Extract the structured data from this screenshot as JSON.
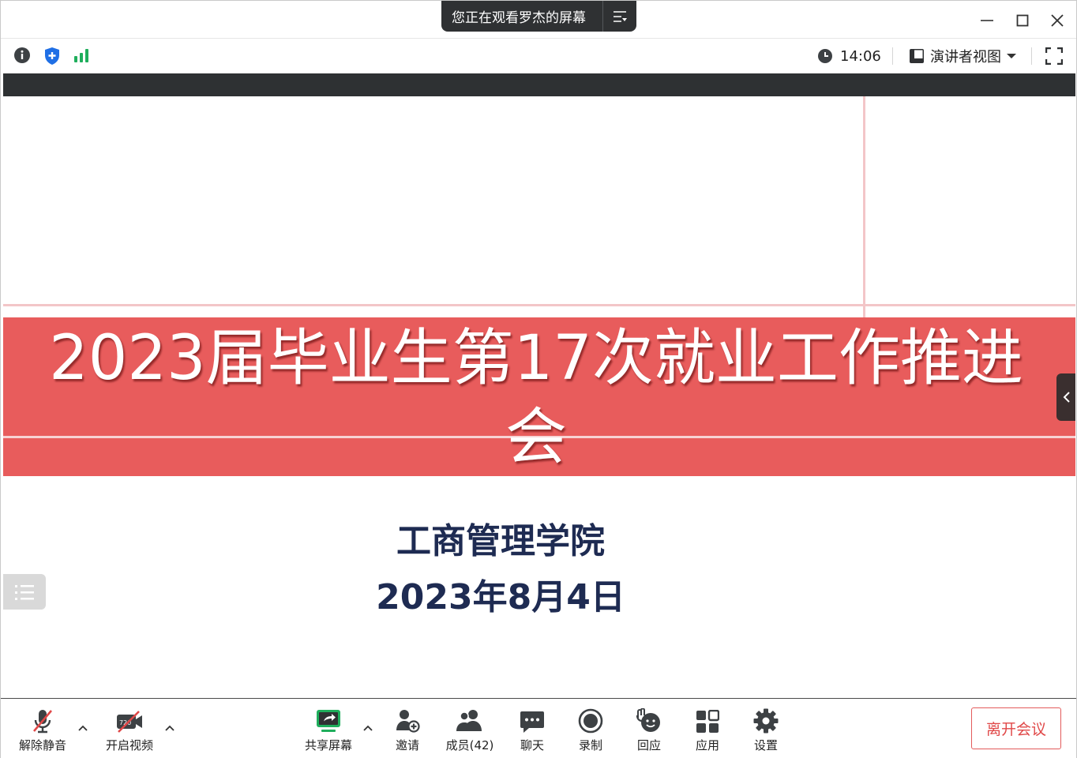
{
  "titlebar": {
    "viewing_text": "您正在观看罗杰的屏幕",
    "icons": [
      "menu-icon",
      "minimize-icon",
      "maximize-icon",
      "close-icon"
    ]
  },
  "infobar": {
    "time": "14:06",
    "view_mode": "演讲者视图",
    "icons": [
      "info-icon",
      "shield-icon",
      "signal-icon",
      "clock-icon",
      "view-icon",
      "fullscreen-icon"
    ]
  },
  "slide": {
    "title": "2023届毕业生第17次就业工作推进会",
    "organizer": "工商管理学院",
    "date": "2023年8月4日",
    "banner_color": "#e85c5c",
    "text_color": "#1e2b52"
  },
  "toolbar": {
    "unmute": "解除静音",
    "start_video": "开启视频",
    "video_badge": "720",
    "share_screen": "共享屏幕",
    "invite": "邀请",
    "participants": "成员(42)",
    "chat": "聊天",
    "record": "录制",
    "reactions": "回应",
    "apps": "应用",
    "settings": "设置",
    "leave": "离开会议",
    "leave_color": "#e04848",
    "share_color": "#1fae5c"
  }
}
